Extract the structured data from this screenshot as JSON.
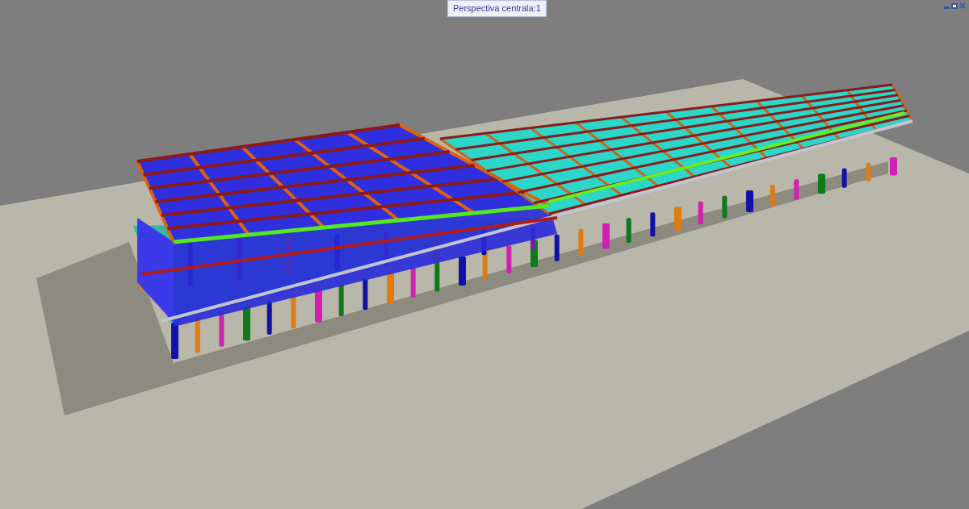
{
  "viewport": {
    "title": "Perspectiva centrala:1"
  }
}
